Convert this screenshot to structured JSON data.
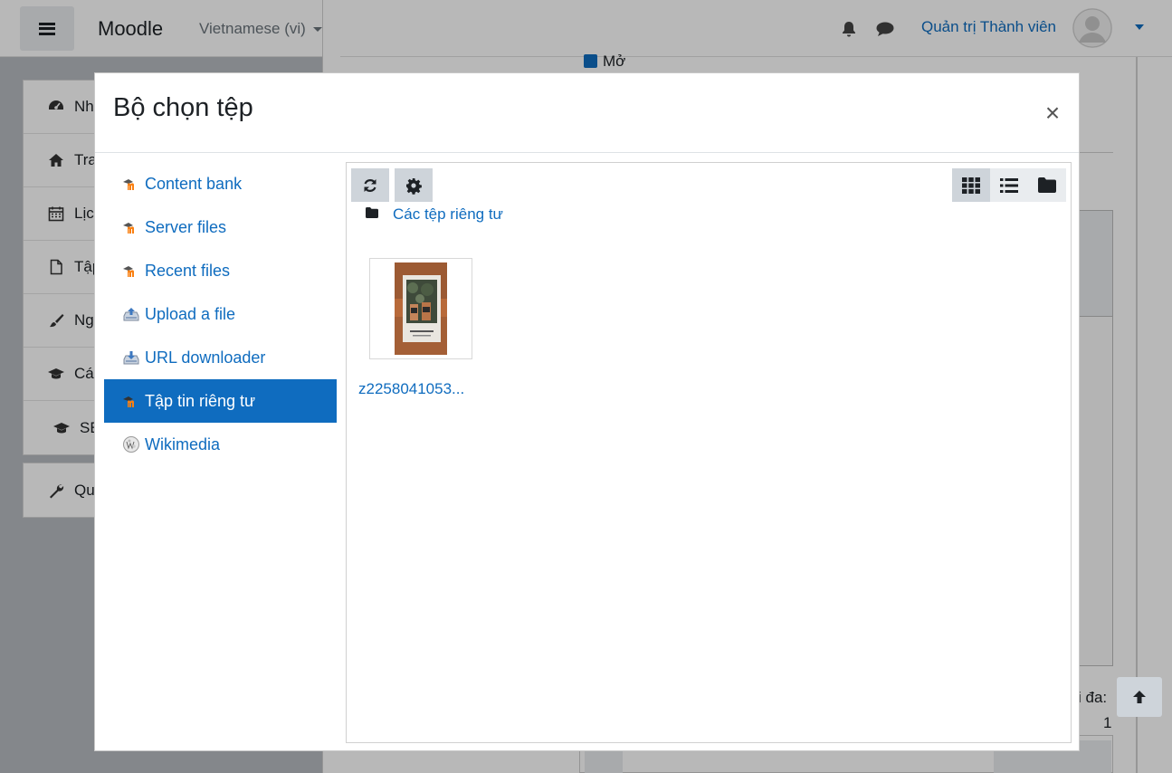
{
  "navbar": {
    "brand": "Moodle",
    "language": "Vietnamese (vi)",
    "user_name": "Quản trị Thành viên"
  },
  "drawer": {
    "items": [
      {
        "label": "Nhà",
        "icon": "dashboard-icon"
      },
      {
        "label": "Trang",
        "icon": "home-icon"
      },
      {
        "label": "Lịch",
        "icon": "calendar-icon"
      },
      {
        "label": "Tập",
        "icon": "file-icon"
      },
      {
        "label": "Ng",
        "icon": "brush-icon"
      },
      {
        "label": "Cá",
        "icon": "graduation-cap-icon"
      },
      {
        "label": "SE",
        "icon": "graduation-cap-icon"
      }
    ],
    "admin_item": {
      "label": "Qu",
      "icon": "wrench-icon"
    }
  },
  "background": {
    "checkbox_label": "Mở",
    "max_label": "i đa:",
    "max_value": "1"
  },
  "modal": {
    "title": "Bộ chọn tệp",
    "close_symbol": "×",
    "repositories": [
      {
        "label": "Content bank",
        "icon": "moodle-icon",
        "active": false
      },
      {
        "label": "Server files",
        "icon": "moodle-icon",
        "active": false
      },
      {
        "label": "Recent files",
        "icon": "moodle-icon",
        "active": false
      },
      {
        "label": "Upload a file",
        "icon": "upload-icon",
        "active": false
      },
      {
        "label": "URL downloader",
        "icon": "download-icon",
        "active": false
      },
      {
        "label": "Tập tin riêng tư",
        "icon": "moodle-icon",
        "active": true
      },
      {
        "label": "Wikimedia",
        "icon": "wikimedia-icon",
        "active": false
      }
    ],
    "toolbar": {
      "refresh_icon": "refresh-icon",
      "settings_icon": "gear-icon",
      "views": [
        "grid-view-icon",
        "list-view-icon",
        "tree-view-icon"
      ],
      "active_view": "grid-view-icon"
    },
    "path": {
      "label": "Các tệp riêng tư"
    },
    "files": [
      {
        "name": "z2258041053..."
      }
    ]
  },
  "colors": {
    "link": "#0f6cbf",
    "active_bg": "#0f6cbf",
    "button_bg": "#ced4da"
  }
}
